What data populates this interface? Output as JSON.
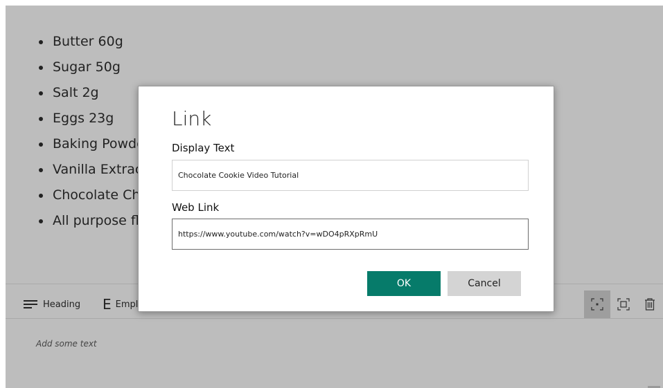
{
  "ingredients": [
    "Butter 60g",
    "Sugar 50g",
    "Salt 2g",
    "Eggs 23g",
    "Baking Powde",
    "Vanilla Extrac",
    "Chocolate Ch",
    "All purpose fl"
  ],
  "toolbar": {
    "heading_label": "Heading",
    "emphasis_label": "Empl",
    "emphasis_glyph": "E",
    "icons": [
      "heading-icon",
      "emphasis-icon",
      "focus-center-icon",
      "focus-frame-icon",
      "trash-icon"
    ]
  },
  "editor": {
    "placeholder": "Add some text"
  },
  "dialog": {
    "title": "Link",
    "display_text_label": "Display Text",
    "display_text_value": "Chocolate Cookie Video Tutorial",
    "web_link_label": "Web Link",
    "web_link_value": "https://www.youtube.com/watch?v=wDO4pRXpRmU",
    "ok_label": "OK",
    "cancel_label": "Cancel"
  },
  "colors": {
    "overlay_gray": "#bdbdbd",
    "ok_button": "#067b6a",
    "cancel_button": "#d4d4d4",
    "active_tool": "#9e9e9e"
  }
}
